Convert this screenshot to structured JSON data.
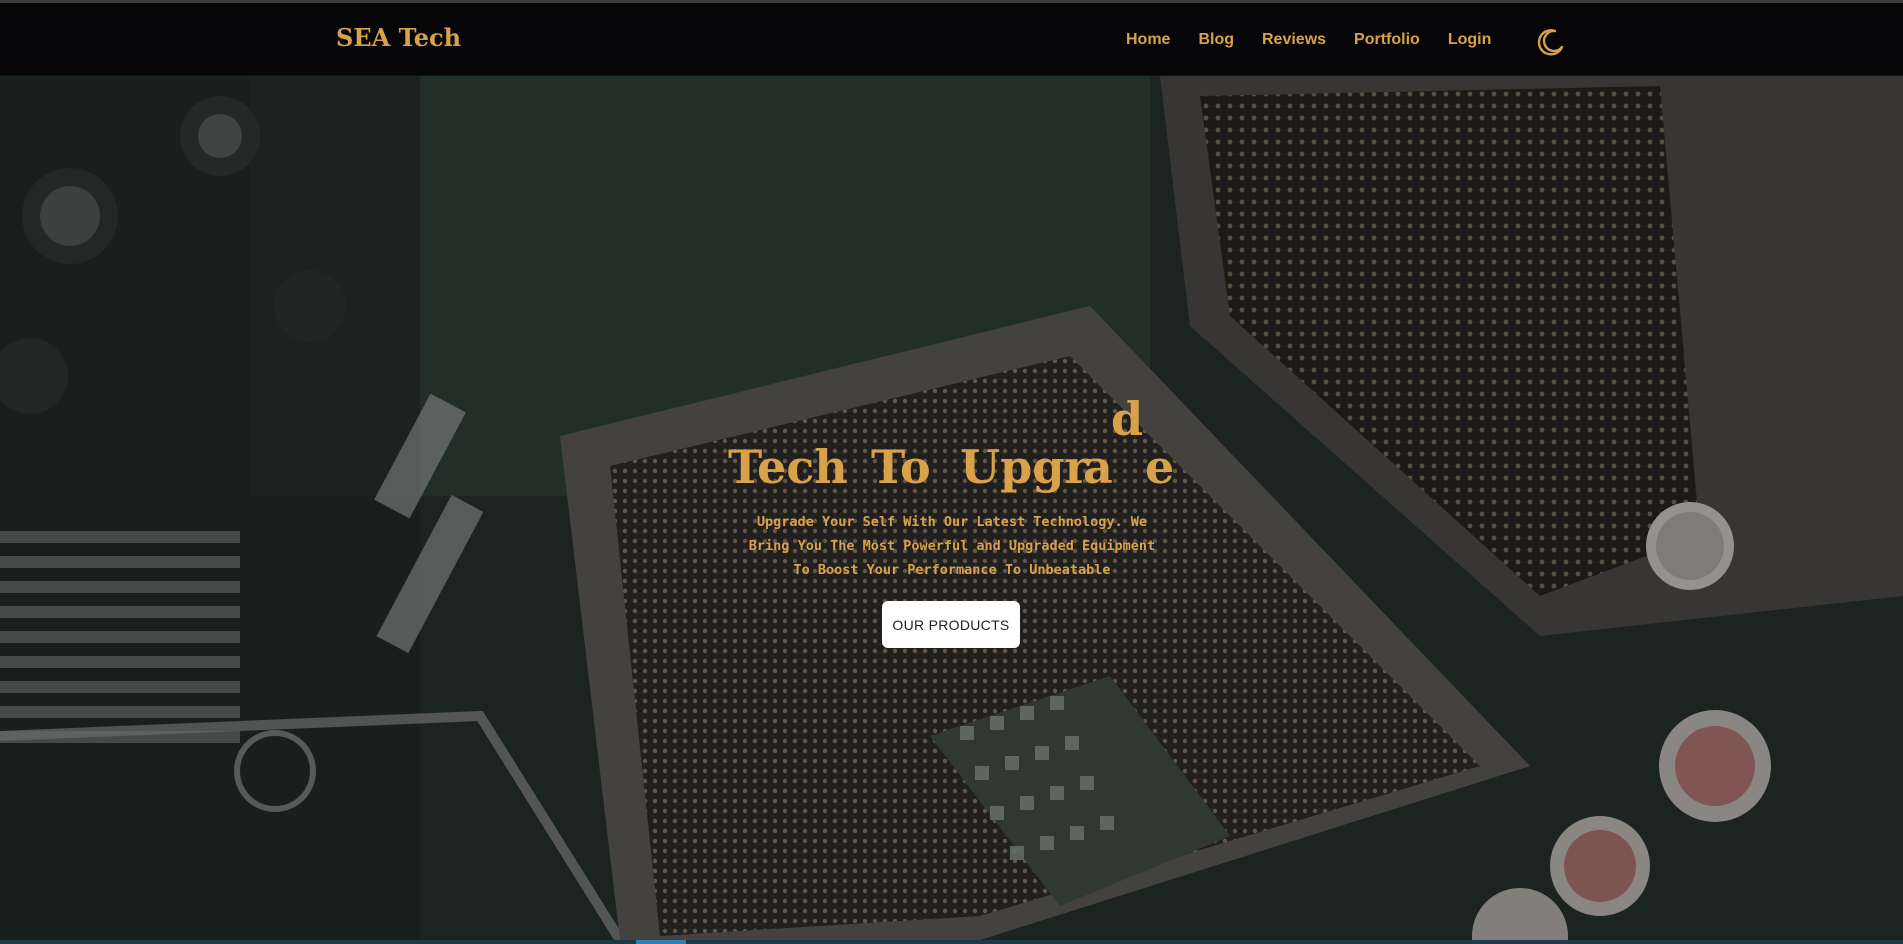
{
  "navbar": {
    "brand": "SEA Tech",
    "links": [
      "Home",
      "Blog",
      "Reviews",
      "Portfolio",
      "Login"
    ],
    "theme_toggle_icon": "moon-icon"
  },
  "hero": {
    "headline_words": [
      "Tech",
      "To",
      "Upgr"
    ],
    "headline_letters": [
      "a",
      "d",
      "e"
    ],
    "subtitle_lines": [
      "Upgrade Your Self With Our Latest Technology. We",
      "Bring You The Most Powerful and Upgraded Equipment",
      "To Boost Your Performance To Unbeatable"
    ],
    "cta_label": "OUR PRODUCTS",
    "background_image": "circuit-board-cpu-socket"
  },
  "colors": {
    "accent": "#d9a24a",
    "navbar_bg": "#060608",
    "button_bg": "#ffffff"
  }
}
